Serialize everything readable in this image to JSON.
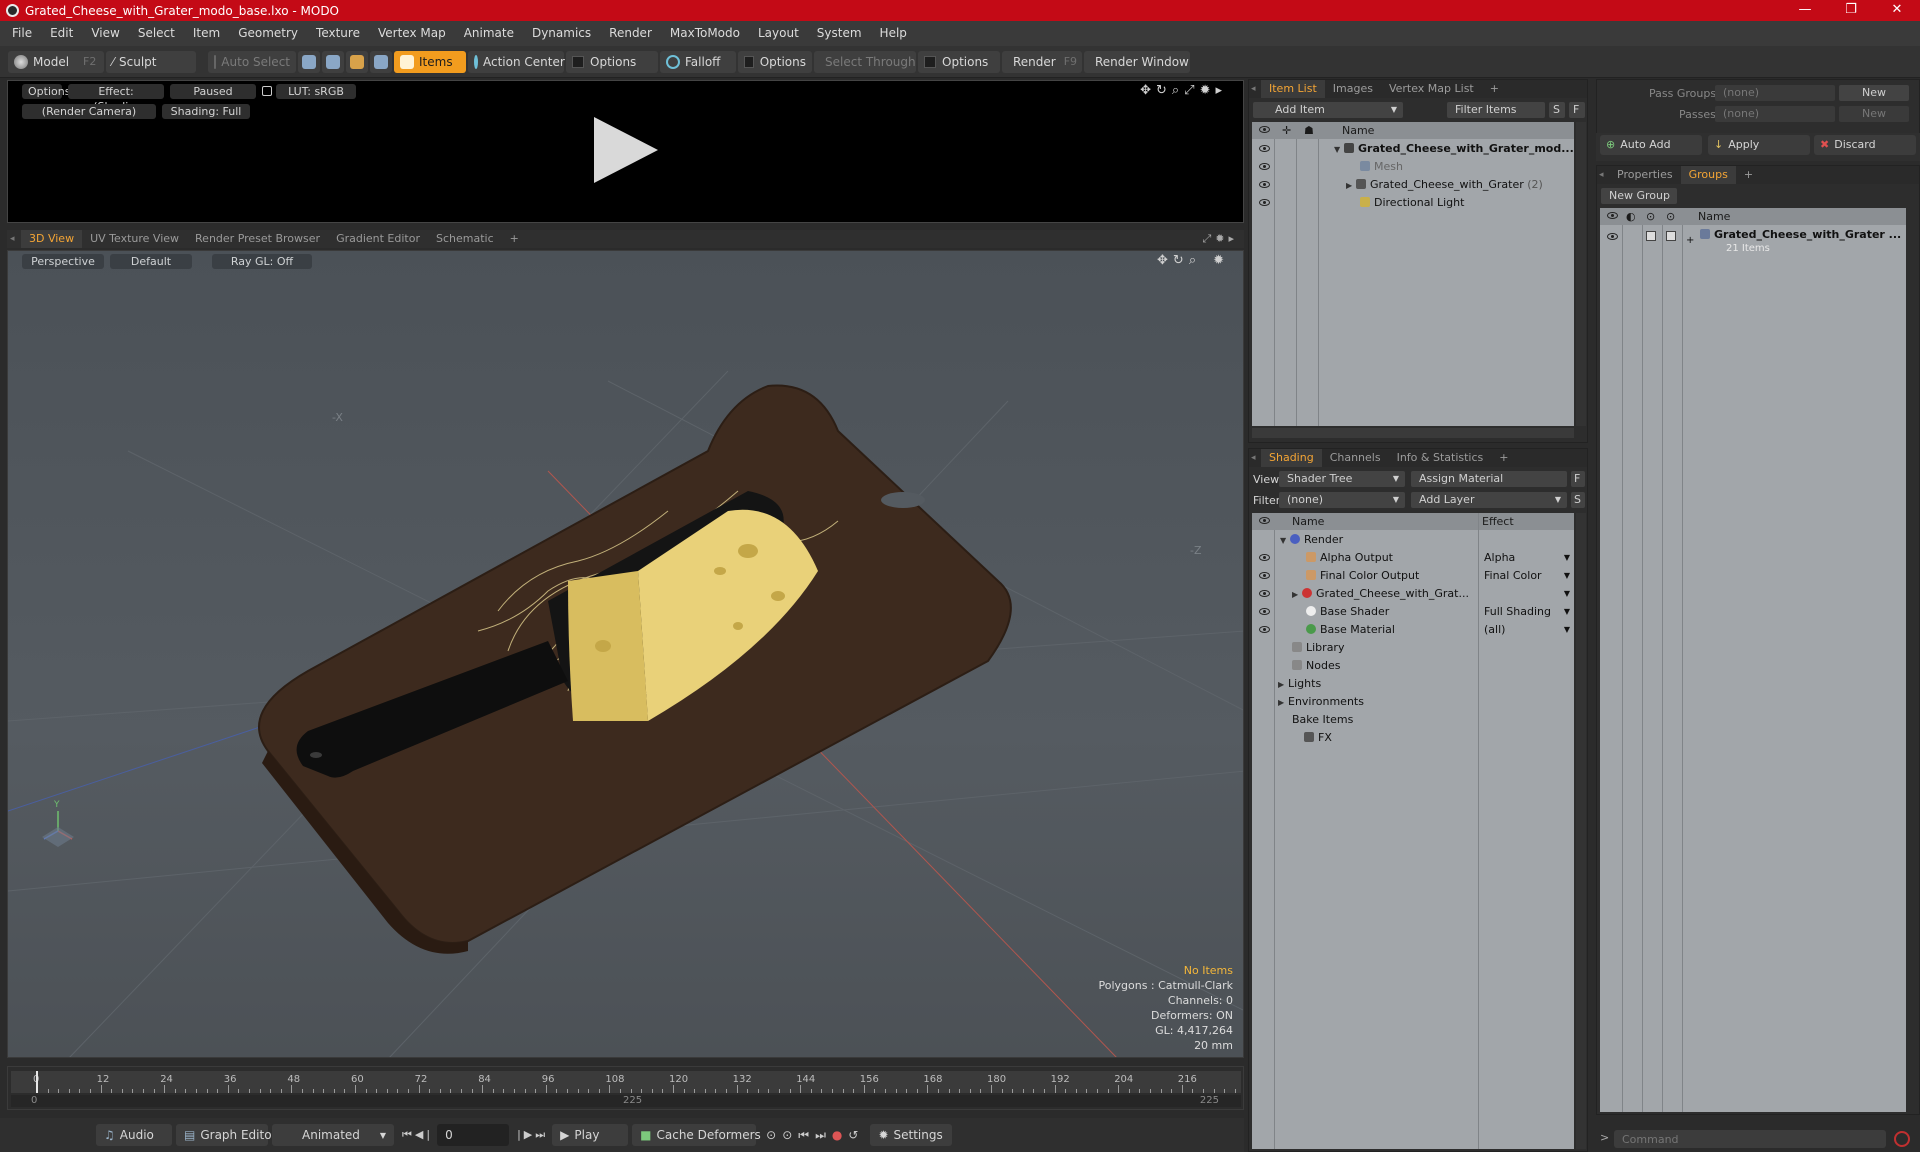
{
  "window": {
    "title": "Grated_Cheese_with_Grater_modo_base.lxo - MODO",
    "minimize": "—",
    "maximize": "❐",
    "close": "✕"
  },
  "menu": [
    "File",
    "Edit",
    "View",
    "Select",
    "Item",
    "Geometry",
    "Texture",
    "Vertex Map",
    "Animate",
    "Dynamics",
    "Render",
    "MaxToModo",
    "Layout",
    "System",
    "Help"
  ],
  "toolbar": {
    "model": "Model",
    "model_key": "F2",
    "sculpt": "Sculpt",
    "auto_select": "Auto Select",
    "items": "Items",
    "action_center": "Action Center",
    "options1": "Options",
    "falloff": "Falloff",
    "options2": "Options",
    "select_through": "Select Through",
    "options3": "Options",
    "render": "Render",
    "render_key": "F9",
    "render_window": "Render Window"
  },
  "render_preview": {
    "options": "Options",
    "effect": "Effect: (Shadi...",
    "paused": "Paused",
    "lut": "LUT: sRGB",
    "camera": "(Render Camera)",
    "shading": "Shading: Full"
  },
  "viewport_tabs": [
    "3D View",
    "UV Texture View",
    "Render Preset Browser",
    "Gradient Editor",
    "Schematic",
    "+"
  ],
  "viewport": {
    "perspective": "Perspective",
    "default": "Default",
    "raygl": "Ray GL: Off",
    "stats": {
      "no_items": "No Items",
      "polygons": "Polygons : Catmull-Clark",
      "channels": "Channels: 0",
      "deformers": "Deformers: ON",
      "gl": "GL: 4,417,264",
      "scale": "20 mm"
    }
  },
  "timeline": {
    "ticks": [
      "0",
      "12",
      "24",
      "36",
      "48",
      "60",
      "72",
      "84",
      "96",
      "108",
      "120",
      "132",
      "144",
      "156",
      "168",
      "180",
      "192",
      "204",
      "216"
    ],
    "sub_start": "0",
    "sub_mid": "225",
    "sub_end": "225"
  },
  "bottombar": {
    "audio": "Audio",
    "graph_editor": "Graph Editor",
    "animated": "Animated",
    "frame": "0",
    "play": "Play",
    "cache_deformers": "Cache Deformers",
    "settings": "Settings"
  },
  "item_list": {
    "tabs": [
      "Item List",
      "Images",
      "Vertex Map List",
      "+"
    ],
    "add_item": "Add Item",
    "filter_items": "Filter Items",
    "s": "S",
    "f": "F",
    "col_name": "Name",
    "rows": [
      {
        "label": "Grated_Cheese_with_Grater_mod...",
        "suffix": ""
      },
      {
        "label": "Mesh",
        "suffix": ""
      },
      {
        "label": "Grated_Cheese_with_Grater",
        "suffix": "(2)"
      },
      {
        "label": "Directional Light",
        "suffix": ""
      }
    ]
  },
  "shading": {
    "tabs": [
      "Shading",
      "Channels",
      "Info & Statistics",
      "+"
    ],
    "view_label": "View",
    "view_value": "Shader Tree",
    "assign_material": "Assign Material",
    "f": "F",
    "filter_label": "Filter",
    "filter_value": "(none)",
    "add_layer": "Add Layer",
    "s": "S",
    "col_name": "Name",
    "col_effect": "Effect",
    "rows": [
      {
        "label": "Render",
        "effect": ""
      },
      {
        "label": "Alpha Output",
        "effect": "Alpha"
      },
      {
        "label": "Final Color Output",
        "effect": "Final Color"
      },
      {
        "label": "Grated_Cheese_with_Grat...",
        "effect": ""
      },
      {
        "label": "Base Shader",
        "effect": "Full Shading"
      },
      {
        "label": "Base Material",
        "effect": "(all)"
      },
      {
        "label": "Library",
        "effect": ""
      },
      {
        "label": "Nodes",
        "effect": ""
      },
      {
        "label": "Lights",
        "effect": ""
      },
      {
        "label": "Environments",
        "effect": ""
      },
      {
        "label": "Bake Items",
        "effect": ""
      },
      {
        "label": "FX",
        "effect": ""
      }
    ]
  },
  "pass_panel": {
    "pass_groups": "Pass Groups",
    "pass_groups_value": "(none)",
    "new": "New",
    "passes": "Passes",
    "passes_value": "(none)",
    "new2": "New",
    "auto_add": "Auto Add",
    "apply": "Apply",
    "discard": "Discard"
  },
  "groups": {
    "tabs": [
      "Properties",
      "Groups",
      "+"
    ],
    "new_group": "New Group",
    "col_name": "Name",
    "group_name": "Grated_Cheese_with_Grater ...",
    "group_count": "21 Items"
  },
  "command": {
    "placeholder": "Command"
  },
  "colors": {
    "titlebar": "#c40a16",
    "accent": "#f29c1e",
    "tab_active": "#f4a535"
  }
}
